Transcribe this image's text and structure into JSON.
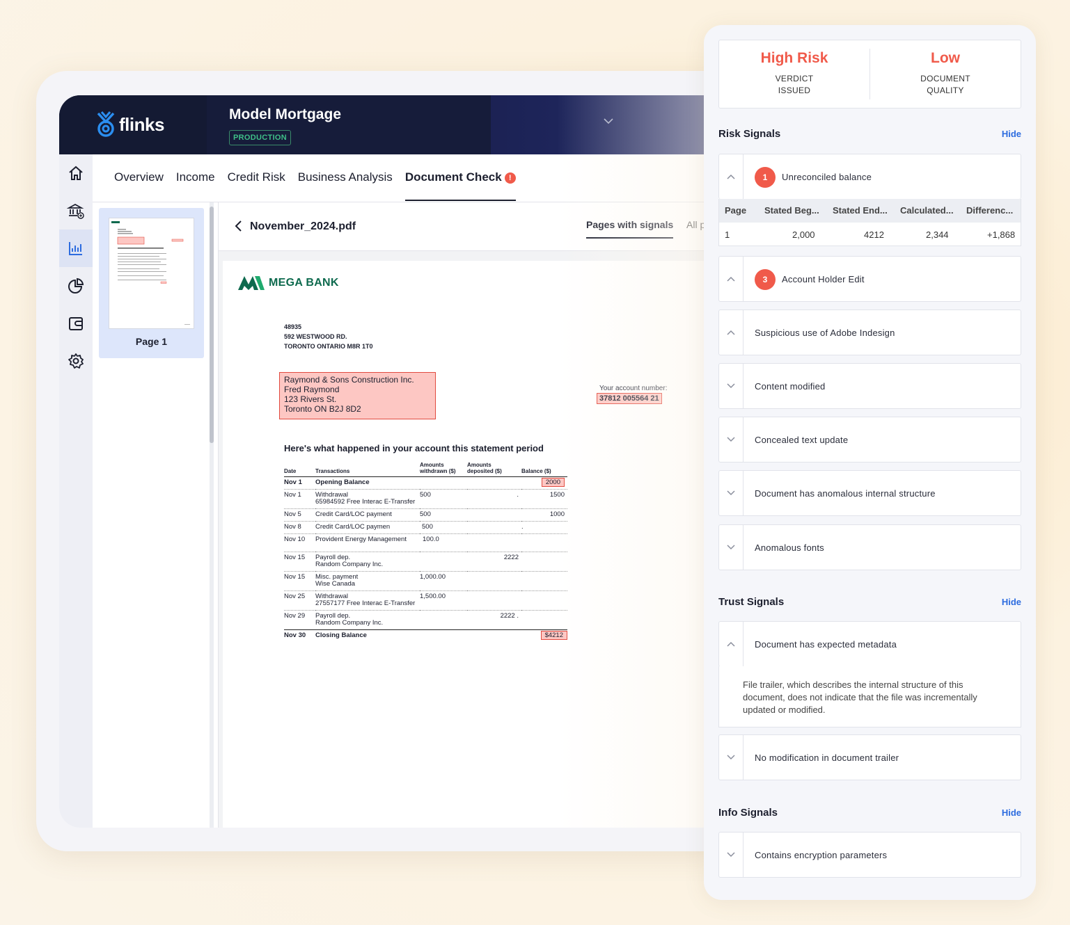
{
  "app": {
    "logo_text": "flinks",
    "project_title": "Model Mortgage",
    "environment": "PRODUCTION"
  },
  "rail_icons": [
    "home-icon",
    "bank-add-icon",
    "bar-chart-icon",
    "pie-chart-icon",
    "wallet-icon",
    "gear-icon"
  ],
  "tabs": [
    {
      "label": "Overview"
    },
    {
      "label": "Income"
    },
    {
      "label": "Credit Risk"
    },
    {
      "label": "Business Analysis"
    },
    {
      "label": "Document Check",
      "alert": "!"
    }
  ],
  "thumbnail": {
    "label": "Page 1"
  },
  "viewer": {
    "file_name": "November_2024.pdf",
    "tab_pages_with_signals": "Pages with signals",
    "tab_all": "All p"
  },
  "document": {
    "bank_name": "MEGA BANK",
    "address_lines": [
      "48935",
      "592 WESTWOOD RD.",
      "TORONTO ONTARIO M8R 1T0"
    ],
    "holder_lines": [
      "Raymond & Sons Construction Inc.",
      "Fred Raymond",
      "123 Rivers St.",
      "Toronto ON B2J 8D2"
    ],
    "account_label": "Your account number:",
    "account_number": "37812 005564 21",
    "statement_title": "Here's what happened in your account this statement period",
    "columns": {
      "date": "Date",
      "transactions": "Transactions",
      "withdrawn_1": "Amounts",
      "withdrawn_2": "withdrawn ($)",
      "deposited_1": "Amounts",
      "deposited_2": "deposited ($)",
      "balance": "Balance ($)"
    },
    "rows": [
      {
        "date": "Nov 1",
        "desc": "Opening Balance",
        "desc2": "",
        "withdrawn": "",
        "deposited": "",
        "balance": "2000"
      },
      {
        "date": "Nov 1",
        "desc": "Withdrawal",
        "desc2": "65984592 Free Interac E-Transfer",
        "withdrawn": "500",
        "deposited": ".",
        "balance": "1500"
      },
      {
        "date": "Nov 5",
        "desc": "Credit Card/LOC payment",
        "desc2": "",
        "withdrawn": "500",
        "deposited": "",
        "balance": "1000"
      },
      {
        "date": "Nov 8",
        "desc": "Credit Card/LOC paymen",
        "desc2": "",
        "withdrawn": "500",
        "deposited": "",
        "balance": "."
      },
      {
        "date": "Nov 10",
        "desc": "Provident Energy Management",
        "desc2": "",
        "withdrawn": "100.0",
        "deposited": "",
        "balance": ""
      },
      {
        "date": "Nov 15",
        "desc": "Payroll dep.",
        "desc2": "Random Company Inc.",
        "withdrawn": "",
        "deposited": "2222",
        "balance": ""
      },
      {
        "date": "Nov 15",
        "desc": "Misc. payment",
        "desc2": "Wise Canada",
        "withdrawn": "1,000.00",
        "deposited": "",
        "balance": ""
      },
      {
        "date": "Nov 25",
        "desc": "Withdrawal",
        "desc2": "27557177 Free Interac E-Transfer",
        "withdrawn": "1,500.00",
        "deposited": "",
        "balance": ""
      },
      {
        "date": "Nov 29",
        "desc": "Payroll dep.",
        "desc2": "Random Company Inc.",
        "withdrawn": "",
        "deposited": "2222 .",
        "balance": ""
      },
      {
        "date": "Nov 30",
        "desc": "Closing Balance",
        "desc2": "",
        "withdrawn": "",
        "deposited": "",
        "balance": "$4212"
      }
    ]
  },
  "verdict": {
    "risk_value": "High Risk",
    "risk_label_1": "VERDICT",
    "risk_label_2": "ISSUED",
    "quality_value": "Low",
    "quality_label_1": "DOCUMENT",
    "quality_label_2": "QUALITY"
  },
  "risk_signals": {
    "title": "Risk Signals",
    "hide": "Hide",
    "items": [
      {
        "label": "Unreconciled balance",
        "count": "1",
        "expanded": true
      },
      {
        "label": "Account Holder Edit",
        "count": "3",
        "expanded": true
      },
      {
        "label": "Suspicious use of Adobe Indesign",
        "expanded": true
      },
      {
        "label": "Content modified",
        "expanded": false
      },
      {
        "label": "Concealed text update",
        "expanded": false
      },
      {
        "label": "Document has anomalous internal structure",
        "expanded": false
      },
      {
        "label": "Anomalous fonts",
        "expanded": false
      }
    ],
    "table": {
      "headers": [
        "Page",
        "Stated Beg...",
        "Stated End...",
        "Calculated...",
        "Differenc..."
      ],
      "row": [
        "1",
        "2,000",
        "4212",
        "2,344",
        "+1,868"
      ]
    }
  },
  "trust_signals": {
    "title": "Trust Signals",
    "hide": "Hide",
    "items": [
      {
        "label": "Document has expected metadata",
        "expanded": true
      },
      {
        "label": "No modification in document trailer",
        "expanded": false
      }
    ],
    "detail": "File trailer, which describes the internal structure of this document, does not indicate that the file was incrementally updated or modified."
  },
  "info_signals": {
    "title": "Info Signals",
    "hide": "Hide",
    "items": [
      {
        "label": "Contains encryption parameters",
        "expanded": false
      }
    ]
  },
  "colors": {
    "accent_red": "#f05a4a",
    "link_blue": "#2d6cdf",
    "brand_navy": "#151a35",
    "bank_green": "#0e6a4e",
    "highlight": "#fdc7c3"
  }
}
